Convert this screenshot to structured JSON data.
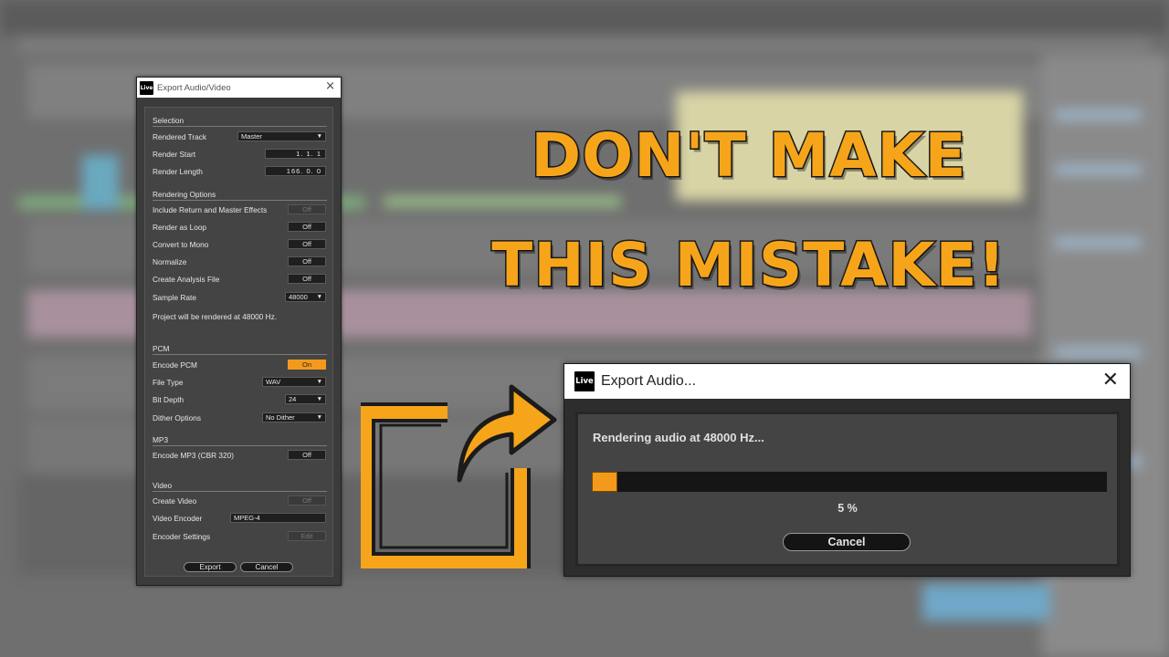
{
  "export_dialog": {
    "logo": "Live",
    "title": "Export Audio/Video",
    "close_icon": "×",
    "selection": {
      "heading": "Selection",
      "rendered_track_label": "Rendered Track",
      "rendered_track_value": "Master",
      "render_start_label": "Render Start",
      "render_start_value": "1.  1.  1",
      "render_length_label": "Render Length",
      "render_length_value": "166.  0.  0"
    },
    "rendering_options": {
      "heading": "Rendering Options",
      "include_return_label": "Include Return and Master Effects",
      "include_return_value": "Off",
      "render_loop_label": "Render as Loop",
      "render_loop_value": "Off",
      "mono_label": "Convert to Mono",
      "mono_value": "Off",
      "normalize_label": "Normalize",
      "normalize_value": "Off",
      "analysis_label": "Create Analysis File",
      "analysis_value": "Off",
      "sample_rate_label": "Sample Rate",
      "sample_rate_value": "48000",
      "info": "Project will be rendered at 48000 Hz."
    },
    "pcm": {
      "heading": "PCM",
      "encode_label": "Encode PCM",
      "encode_value": "On",
      "file_type_label": "File Type",
      "file_type_value": "WAV",
      "bit_depth_label": "Bit Depth",
      "bit_depth_value": "24",
      "dither_label": "Dither Options",
      "dither_value": "No Dither"
    },
    "mp3": {
      "heading": "MP3",
      "encode_label": "Encode MP3 (CBR 320)",
      "encode_value": "Off"
    },
    "video": {
      "heading": "Video",
      "create_label": "Create Video",
      "create_value": "Off",
      "encoder_label": "Video Encoder",
      "encoder_value": "MPEG-4",
      "settings_label": "Encoder Settings",
      "settings_value": "Edit"
    },
    "export_button": "Export",
    "cancel_button": "Cancel"
  },
  "headline": {
    "line1": "DON'T MAKE",
    "line2": "THIS MISTAKE!"
  },
  "render_dialog": {
    "logo": "Live",
    "title": "Export Audio...",
    "close_icon": "✕",
    "status": "Rendering audio at 48000 Hz...",
    "progress_fraction": 0.05,
    "progress_label": "5 %",
    "cancel_button": "Cancel"
  },
  "colors": {
    "accent": "#f39a1c",
    "headline": "#f6a51a"
  },
  "icons": {
    "export": "export-share-icon"
  }
}
